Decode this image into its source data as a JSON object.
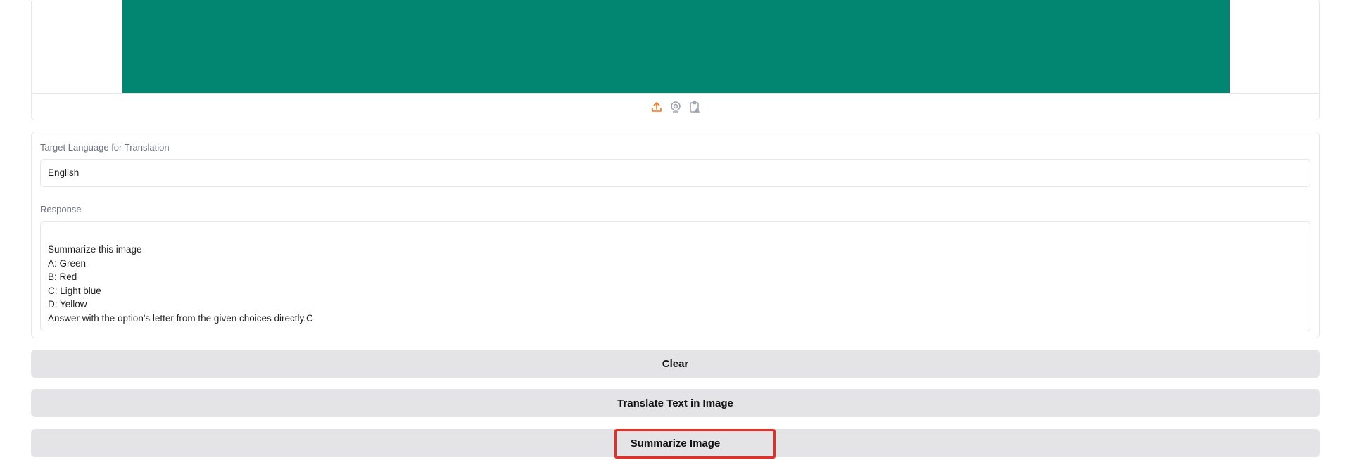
{
  "image_input": {
    "preview_color": "#028672",
    "toolbar_icons": [
      "upload-icon",
      "webcam-icon",
      "clipboard-image-icon"
    ],
    "accent_color": "#f97316"
  },
  "translation": {
    "target_language_label": "Target Language for Translation",
    "target_language_value": "English"
  },
  "response": {
    "label": "Response",
    "lines": [
      "Summarize this image",
      "A: Green",
      "B: Red",
      "C: Light blue",
      "D: Yellow",
      "Answer with the option's letter from the given choices directly.C"
    ]
  },
  "buttons": {
    "clear": "Clear",
    "translate": "Translate Text in Image",
    "summarize": "Summarize Image"
  },
  "highlight_color": "#ee2a24"
}
